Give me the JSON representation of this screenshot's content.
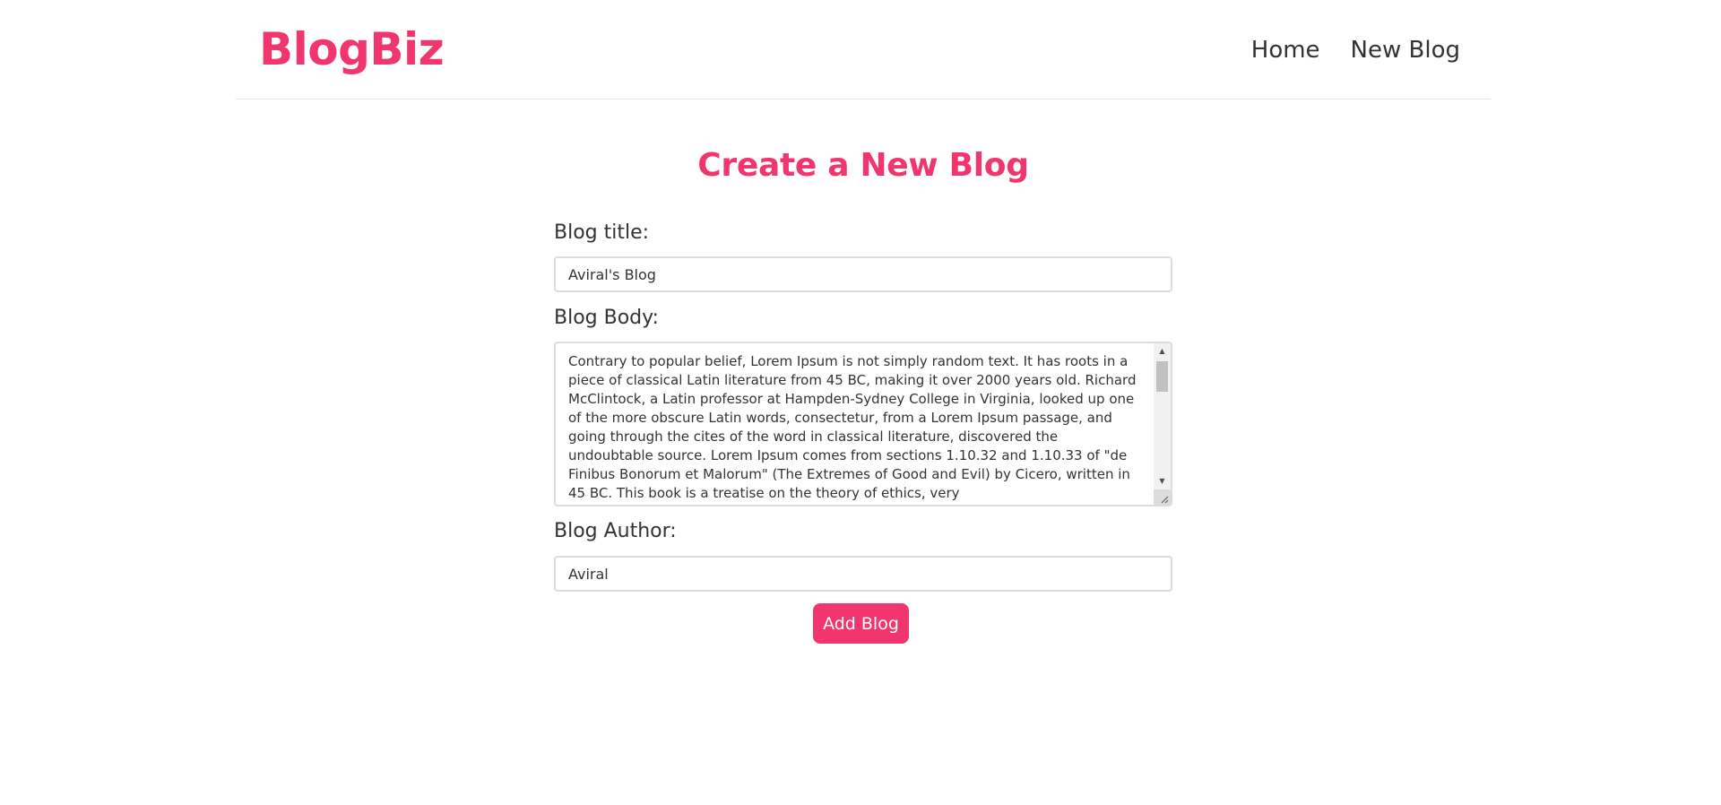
{
  "navbar": {
    "logo": "BlogBiz",
    "links": [
      "Home",
      "New Blog"
    ]
  },
  "form": {
    "title": "Create a New Blog",
    "title_label": "Blog title:",
    "title_value": "Aviral's Blog",
    "body_label": "Blog Body:",
    "body_value": "Contrary to popular belief, Lorem Ipsum is not simply random text. It has roots in a piece of classical Latin literature from 45 BC, making it over 2000 years old. Richard McClintock, a Latin professor at Hampden-Sydney College in Virginia, looked up one of the more obscure Latin words, consectetur, from a Lorem Ipsum passage, and going through the cites of the word in classical literature, discovered the undoubtable source. Lorem Ipsum comes from sections 1.10.32 and 1.10.33 of \"de Finibus Bonorum et Malorum\" (The Extremes of Good and Evil) by Cicero, written in 45 BC. This book is a treatise on the theory of ethics, very",
    "author_label": "Blog Author:",
    "author_value": "Aviral",
    "submit_label": "Add Blog"
  },
  "colors": {
    "accent": "#f1356d",
    "text": "#333333",
    "border": "#dddddd"
  }
}
